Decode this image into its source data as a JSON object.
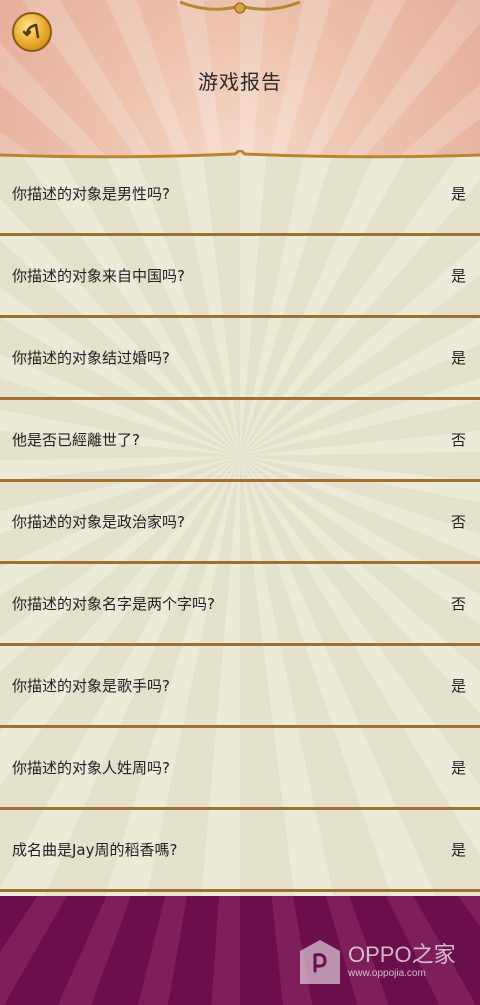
{
  "header": {
    "title": "游戏报告",
    "back_icon": "back-arrow-icon"
  },
  "report": {
    "rows": [
      {
        "question": "你描述的对象是男性吗?",
        "answer": "是"
      },
      {
        "question": "你描述的对象来自中国吗?",
        "answer": "是"
      },
      {
        "question": "你描述的对象结过婚吗?",
        "answer": "是"
      },
      {
        "question": "他是否已經離世了?",
        "answer": "否"
      },
      {
        "question": "你描述的对象是政治家吗?",
        "answer": "否"
      },
      {
        "question": "你描述的对象名字是两个字吗?",
        "answer": "否"
      },
      {
        "question": "你描述的对象是歌手吗?",
        "answer": "是"
      },
      {
        "question": "你描述的对象人姓周吗?",
        "answer": "是"
      },
      {
        "question": "成名曲是Jay周的稻香嗎?",
        "answer": "是"
      }
    ]
  },
  "watermark": {
    "brand": "OPPO之家",
    "url": "www.oppojia.com"
  },
  "colors": {
    "header_bg": "#eec3ae",
    "panel_bg": "#e4e1cc",
    "divider": "#a0702e",
    "footer_bg": "#6a0f4c",
    "button_gold": "#e3a323"
  }
}
